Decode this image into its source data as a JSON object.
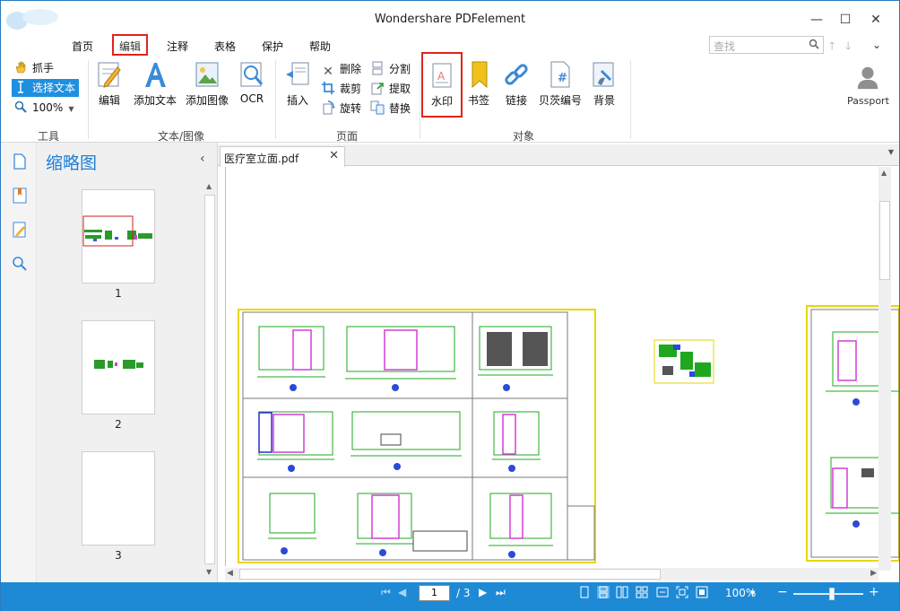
{
  "window": {
    "title": "Wondershare PDFelement",
    "minimize": "—",
    "maximize": "☐",
    "close": "✕",
    "collapse": "⌄"
  },
  "menu": {
    "items": [
      {
        "label": "首页"
      },
      {
        "label": "编辑"
      },
      {
        "label": "注释"
      },
      {
        "label": "表格"
      },
      {
        "label": "保护"
      },
      {
        "label": "帮助"
      }
    ],
    "active": "编辑"
  },
  "search": {
    "placeholder": "查找"
  },
  "ribbon": {
    "tools": {
      "hand": "抓手",
      "select_text": "选择文本",
      "zoom": "100%",
      "group_label": "工具"
    },
    "text_image": {
      "edit": "编辑",
      "add_text": "添加文本",
      "add_image": "添加图像",
      "ocr": "OCR",
      "group_label": "文本/图像"
    },
    "pages": {
      "insert": "插入",
      "delete": "删除",
      "crop": "裁剪",
      "rotate": "旋转",
      "split": "分割",
      "extract": "提取",
      "replace": "替换",
      "group_label": "页面"
    },
    "objects": {
      "watermark": "水印",
      "bookmark": "书签",
      "link": "链接",
      "bates": "贝茨编号",
      "background": "背景",
      "group_label": "对象"
    },
    "passport": "Passport"
  },
  "thumbnails": {
    "title": "缩略图",
    "collapse": "‹",
    "pages": [
      "1",
      "2",
      "3"
    ]
  },
  "document": {
    "tab_name": "医疗室立面.pdf",
    "tab_close": "✕"
  },
  "status": {
    "current_page": "1",
    "total_pages": "/ 3",
    "zoom": "100%",
    "zoom_minus": "−",
    "zoom_plus": "+",
    "zoom_slider_level": 0.55
  },
  "colors": {
    "accent": "#1e8ad6",
    "highlight_border": "#e0231c",
    "selected": "#1e90e0"
  }
}
